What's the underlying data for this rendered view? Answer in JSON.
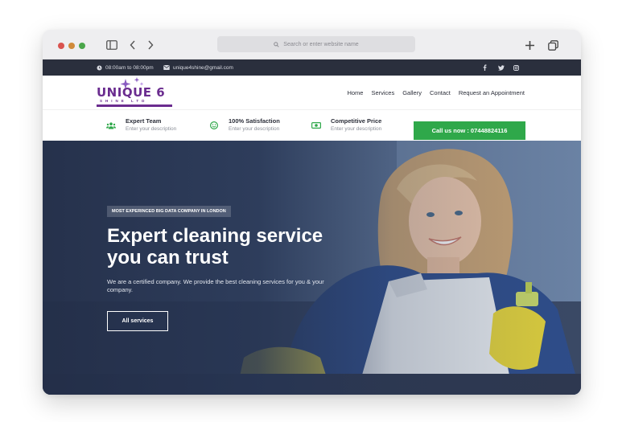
{
  "browser": {
    "address_placeholder": "Search or enter website name"
  },
  "topbar": {
    "hours": "08:00am to 08:00pm",
    "email": "unique4shine@gmail.com",
    "social": [
      "facebook-icon",
      "twitter-icon",
      "instagram-icon"
    ]
  },
  "brand": {
    "logo_text": "UNIQUE 6",
    "logo_sub": "SHINE LTD",
    "logo_color": "#6a2c8f"
  },
  "nav": {
    "items": [
      "Home",
      "Services",
      "Gallery",
      "Contact",
      "Request an Appointment"
    ]
  },
  "features": [
    {
      "title": "Expert Team",
      "desc": "Enter your description",
      "icon": "team-icon"
    },
    {
      "title": "100% Satisfaction",
      "desc": "Enter your description",
      "icon": "smile-icon"
    },
    {
      "title": "Competitive Price",
      "desc": "Enter your description",
      "icon": "money-icon"
    }
  ],
  "call_button": "Call us now : 07448824116",
  "hero": {
    "badge": "MOST EXPERINCED BIG DATA COMPANY IN LONDON",
    "headline_line1": "Expert cleaning service",
    "headline_line2": "you can trust",
    "description": "We are a certified company. We provide the best cleaning services for you & your company.",
    "cta": "All services"
  },
  "colors": {
    "accent_green": "#2fa84a",
    "topbar_bg": "#2a2f3d",
    "hero_overlay": "#263452"
  }
}
